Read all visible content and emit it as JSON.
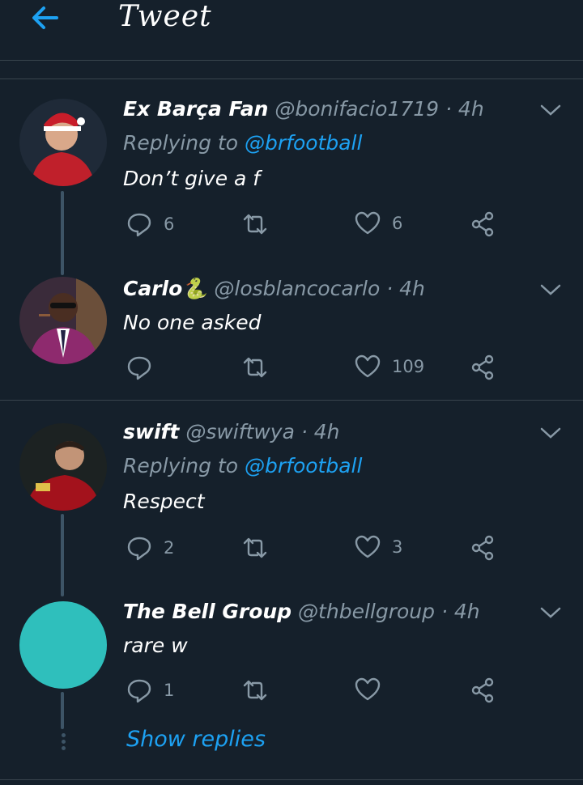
{
  "header": {
    "title": "Tweet"
  },
  "tweets": [
    {
      "display_name": "Ex Barça Fan",
      "handle": "@bonifacio1719 · 4h",
      "replying_prefix": "Replying to ",
      "replying_to": "@brfootball",
      "text": "Don’t give a f",
      "replies": "6",
      "retweets": "",
      "likes": "6",
      "avatar_color": "#b5262e"
    },
    {
      "display_name": "Carlo🐍",
      "handle": "@losblancocarlo · 4h",
      "text": "No one asked",
      "replies": "",
      "retweets": "",
      "likes": "109",
      "avatar_color": "#8e2a6e"
    },
    {
      "display_name": "swift",
      "handle": "@swiftwya · 4h",
      "replying_prefix": "Replying to ",
      "replying_to": "@brfootball",
      "text": "Respect",
      "replies": "2",
      "retweets": "",
      "likes": "3",
      "avatar_color": "#2a2d2d"
    },
    {
      "display_name": "The Bell Group",
      "handle": "@thbellgroup · 4h",
      "text": "rare w",
      "replies": "1",
      "retweets": "",
      "likes": "",
      "avatar_color": "#2fbfbc"
    }
  ],
  "show_replies": "Show replies",
  "colors": {
    "background": "#15202b",
    "accent": "#1da1f2",
    "muted": "#8899a6",
    "border": "#38444d"
  },
  "icons": [
    "back-arrow-icon",
    "chevron-down-icon",
    "reply-icon",
    "retweet-icon",
    "like-icon",
    "share-icon"
  ]
}
